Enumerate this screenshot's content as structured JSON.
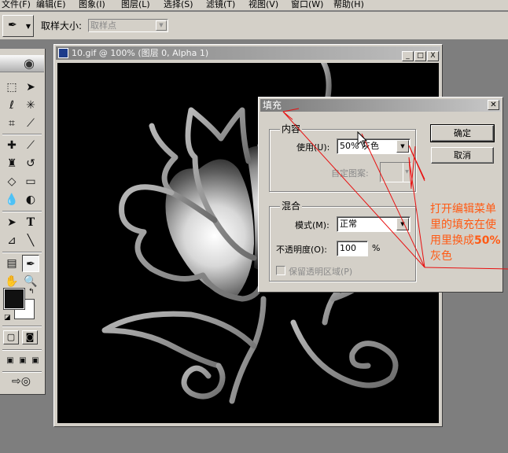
{
  "menubar": {
    "items": [
      "文件(F)",
      "编辑(E)",
      "图象(I)",
      "图层(L)",
      "选择(S)",
      "滤镜(T)",
      "视图(V)",
      "窗口(W)",
      "帮助(H)"
    ]
  },
  "options_bar": {
    "tool_icon": "eyedropper-icon",
    "sample_size_label": "取样大小:",
    "sample_size_value": "取样点"
  },
  "toolbox": {
    "tools": [
      "marquee-icon",
      "move-icon",
      "lasso-icon",
      "magic-wand-icon",
      "crop-icon",
      "slice-icon",
      "healing-brush-icon",
      "brush-icon",
      "clone-stamp-icon",
      "history-brush-icon",
      "eraser-icon",
      "gradient-icon",
      "blur-icon",
      "dodge-icon",
      "path-select-icon",
      "type-icon",
      "pen-icon",
      "line-icon",
      "notes-icon",
      "eyedropper-icon",
      "hand-icon",
      "zoom-icon"
    ],
    "foreground_color": "#111111",
    "background_color": "#ffffff"
  },
  "document": {
    "title": "10.gif @ 100% (图层 0, Alpha 1)",
    "window_buttons": [
      "_",
      "□",
      "X"
    ]
  },
  "fill_dialog": {
    "title": "填充",
    "contents_group": "内容",
    "use_label": "使用(U):",
    "use_value": "50% 灰色",
    "custom_pattern_label": "自定图案:",
    "blending_group": "混合",
    "mode_label": "模式(M):",
    "mode_value": "正常",
    "opacity_label": "不透明度(O):",
    "opacity_value": "100",
    "opacity_unit": "%",
    "preserve_transparency_label": "保留透明区域(P)",
    "ok_label": "确定",
    "cancel_label": "取消"
  },
  "annotation": {
    "line1": "打开编辑菜单",
    "line2": "里的填充在使",
    "line3_prefix": "用里换成",
    "line3_emph": "50%",
    "line4": "灰色",
    "color": "#ff5a14"
  }
}
